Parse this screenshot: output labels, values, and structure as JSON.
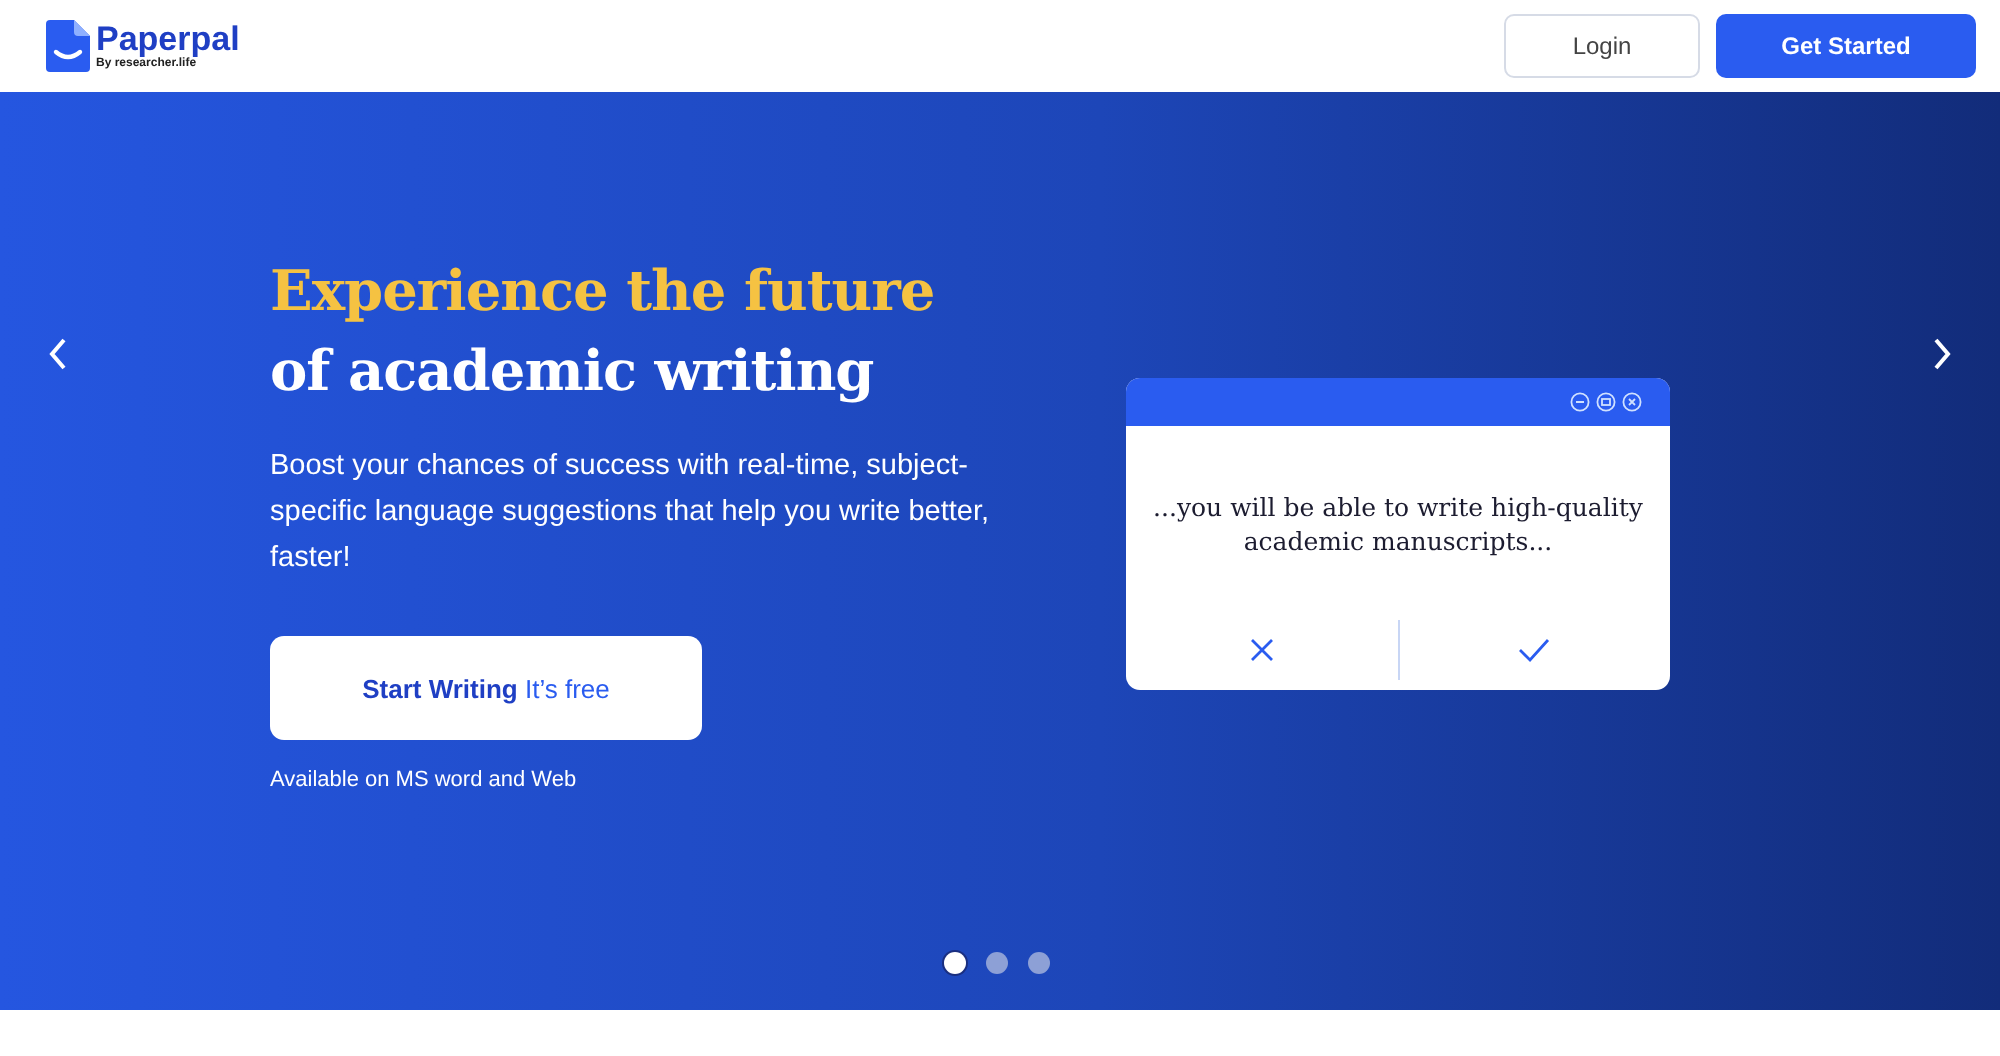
{
  "header": {
    "logo": {
      "name": "Paperpal",
      "tagline": "By researcher.life"
    },
    "buttons": [
      {
        "label": "Login",
        "kind": "outline"
      },
      {
        "label": "Get Started",
        "kind": "primary"
      }
    ]
  },
  "hero": {
    "title_line_1": "Experience the future",
    "title_line_2": "of academic writing",
    "description": "Boost your chances of success with real-time, subject-specific language suggestions that help you write better, faster!",
    "cta": "**Start Writing** It’s free",
    "availability": "Available on MS word and Web",
    "card": {
      "text": "...you will be able to write high-quality academic manuscripts..."
    },
    "slides": [
      {
        "selected": true
      },
      {
        "selected": false
      },
      {
        "selected": false
      }
    ]
  }
}
